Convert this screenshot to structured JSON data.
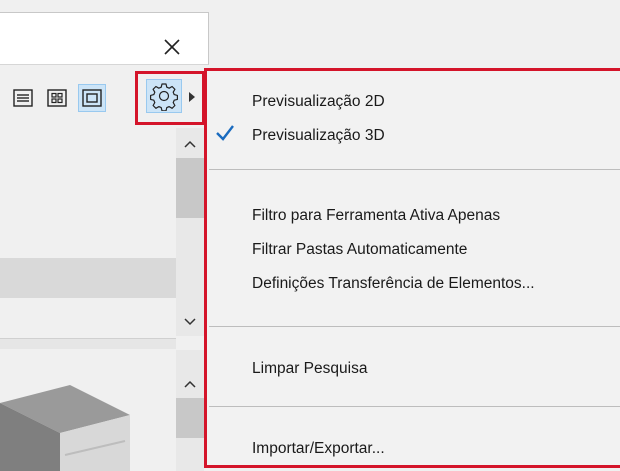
{
  "window": {
    "close_label": "Fechar"
  },
  "toolbar": {
    "buttons": [
      {
        "icon": "list-view-icon"
      },
      {
        "icon": "grid-view-icon"
      },
      {
        "icon": "single-view-icon",
        "selected": true
      },
      {
        "icon": "gear-icon",
        "selected": true
      }
    ]
  },
  "menu": {
    "items": [
      {
        "label": "Previsualização 2D",
        "checked": false
      },
      {
        "label": "Previsualização 3D",
        "checked": true
      },
      {
        "label": "Filtro para Ferramenta Ativa Apenas"
      },
      {
        "label": "Filtrar Pastas Automaticamente"
      },
      {
        "label": "Definições Transferência de Elementos..."
      },
      {
        "label": "Limpar Pesquisa"
      },
      {
        "label": "Importar/Exportar..."
      }
    ]
  },
  "colors": {
    "highlight_border": "#d4142a",
    "selected_bg": "#cce4f7",
    "selected_border": "#99c9ef",
    "check": "#1a6bbf"
  }
}
